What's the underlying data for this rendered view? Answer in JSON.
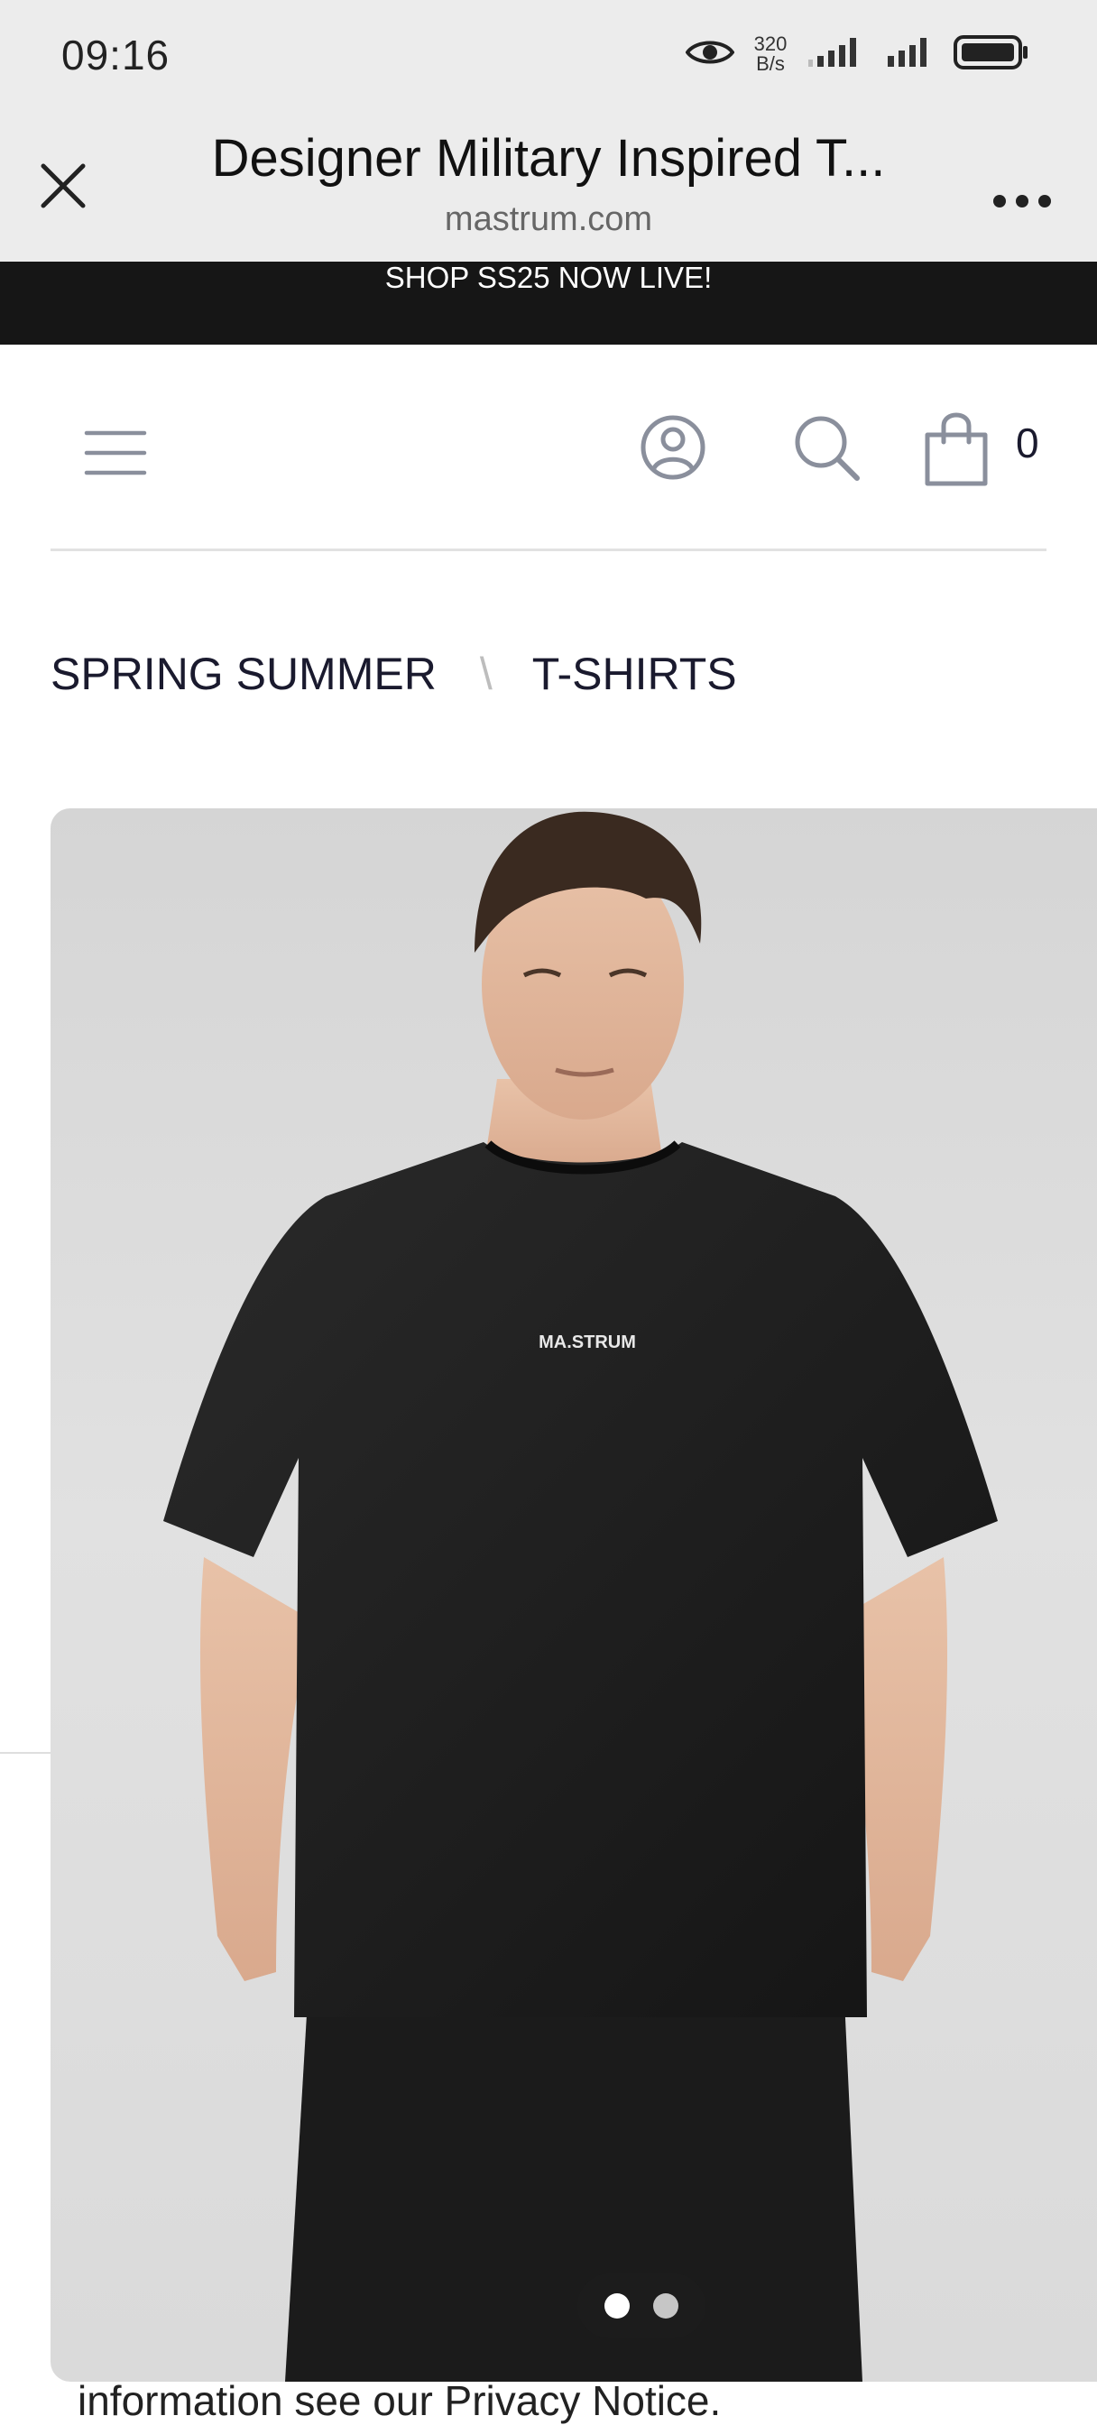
{
  "status_bar": {
    "time": "09:16",
    "net_speed_value": "320",
    "net_speed_unit": "B/s",
    "icons": [
      "eye-icon",
      "signal-icon",
      "signal-icon",
      "battery-icon"
    ]
  },
  "browser": {
    "page_title": "Designer Military Inspired T...",
    "domain": "mastrum.com",
    "close_icon": "close-icon",
    "more_icon": "more-icon"
  },
  "promo": {
    "text": "SHOP SS25 NOW LIVE!"
  },
  "site_header": {
    "cart_count": "0",
    "icons": [
      "menu-icon",
      "account-icon",
      "search-icon",
      "bag-icon"
    ]
  },
  "breadcrumb": {
    "items": [
      "SPRING SUMMER",
      "T-SHIRTS"
    ],
    "separator": "\\"
  },
  "product": {
    "image_alt": "MA.STRUM black t-shirt on model",
    "shirt_logo": "MA.STRUM",
    "gallery_pages": 2,
    "gallery_active": 1
  },
  "cookie": {
    "text_prefix": "information see our ",
    "link": "Privacy Notice",
    "text_suffix": "."
  },
  "colors": {
    "chrome_bg": "#ececec",
    "promo_bg": "#161616",
    "text_dark": "#1a1a2e",
    "icon_gray": "#8a8f9c"
  }
}
